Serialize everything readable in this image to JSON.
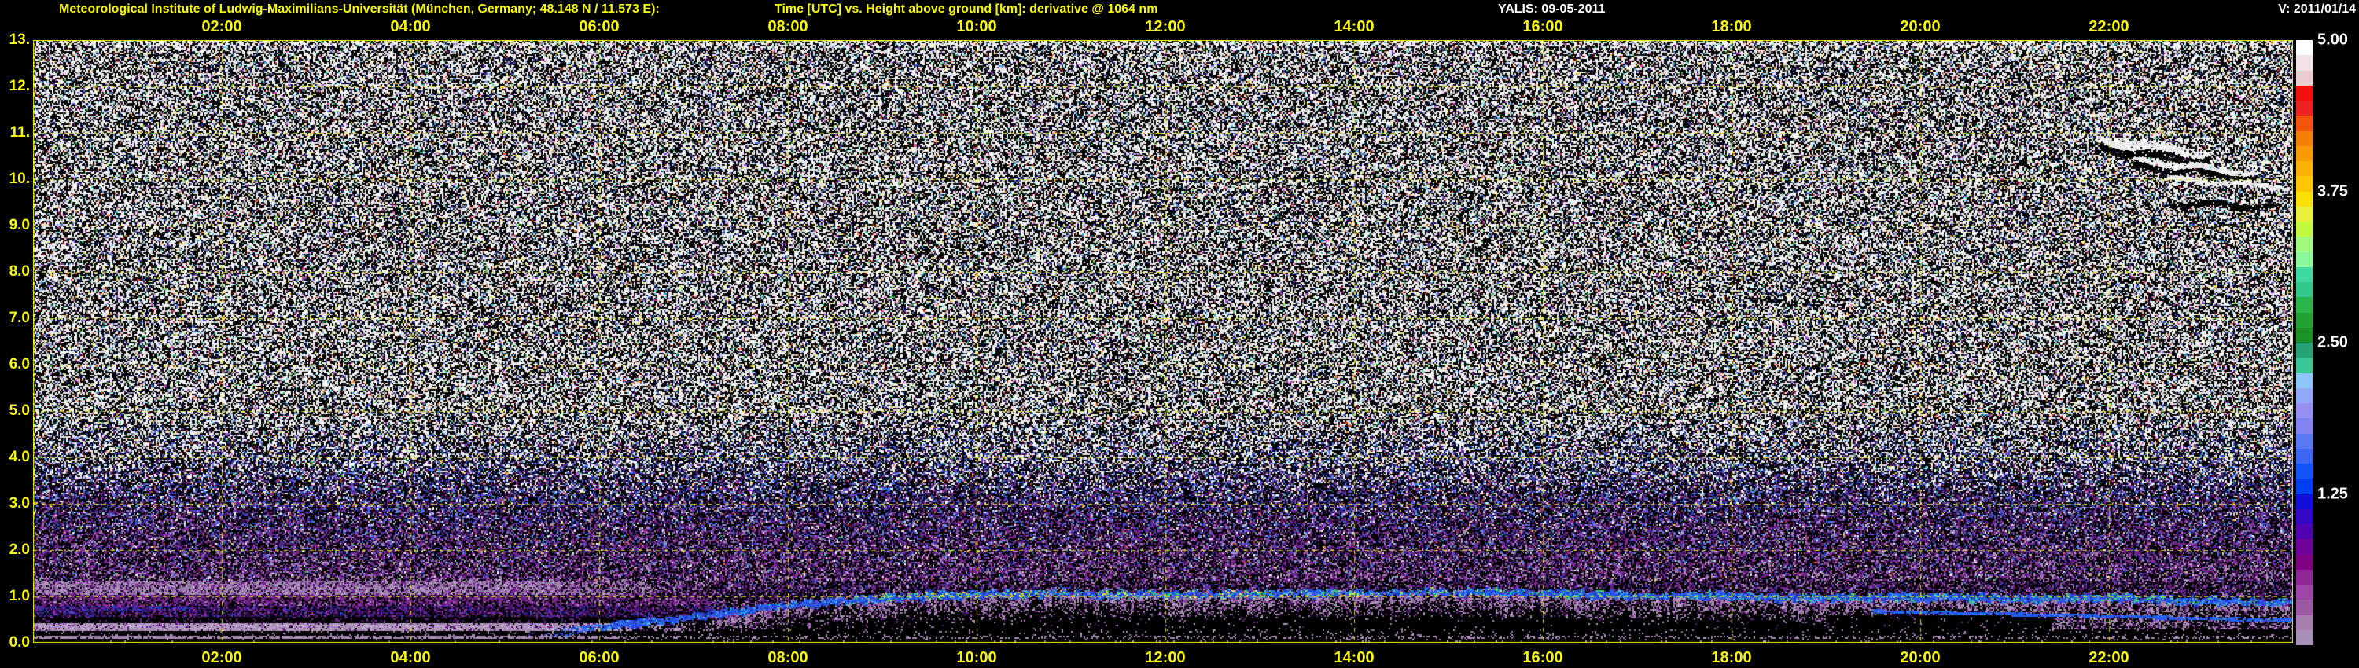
{
  "header": {
    "station": "Meteorological Institute of Ludwig-Maximilians-Universität (München, Germany; 48.148 N / 11.573 E):",
    "plot_title": "Time [UTC] vs. Height above ground [km]: derivative @ 1064 nm",
    "system_date": "YALIS: 09-05-2011",
    "version": "V: 2011/01/14"
  },
  "colors": {
    "background": "#000000",
    "frame": "#f0f000",
    "grid": "#e2e200",
    "label_yellow": "#f8f800",
    "label_white": "#ffffff"
  },
  "chart_data": {
    "type": "heatmap",
    "title": "Time [UTC] vs. Height above ground [km]: derivative @ 1064 nm",
    "wavelength": "1064 nm",
    "date": "09-05-2011",
    "x_axis": {
      "label": "Time [UTC]",
      "range_hours": [
        0,
        24
      ],
      "tick_hours": [
        2,
        4,
        6,
        8,
        10,
        12,
        14,
        16,
        18,
        20,
        22
      ],
      "ticks": [
        "02:00",
        "04:00",
        "06:00",
        "08:00",
        "10:00",
        "12:00",
        "14:00",
        "16:00",
        "18:00",
        "20:00",
        "22:00"
      ]
    },
    "y_axis": {
      "label": "Height above ground [km]",
      "range_km": [
        0,
        13
      ],
      "tick_values": [
        13,
        12,
        11,
        10,
        9,
        8,
        7,
        6,
        5,
        4,
        3,
        2,
        1,
        0
      ],
      "tick_labels": [
        "13.",
        "12.",
        "11.",
        "10.",
        "9.0",
        "8.0",
        "7.0",
        "6.0",
        "5.0",
        "4.0",
        "3.0",
        "2.0",
        "1.0",
        "0.0"
      ]
    },
    "colorbar": {
      "range": [
        0,
        5
      ],
      "tick_values": [
        5.0,
        3.75,
        2.5,
        1.25
      ],
      "tick_labels": [
        "5.00",
        "3.75",
        "2.50",
        "1.25"
      ],
      "colors": [
        "#ffffff",
        "#f2e4e6",
        "#eaccd0",
        "#f50f0f",
        "#ee2222",
        "#f4530a",
        "#f67f06",
        "#f89a02",
        "#fbb201",
        "#fcc601",
        "#fadf00",
        "#e8f03c",
        "#c2f83e",
        "#a2f87c",
        "#8bf89b",
        "#3edaa2",
        "#32c88c",
        "#2ab44c",
        "#22a232",
        "#1c9224",
        "#27a276",
        "#3bc698",
        "#8ec6f8",
        "#8fa8f8",
        "#988ff2",
        "#8282f0",
        "#5a78f2",
        "#3e66f4",
        "#1256fa",
        "#0140f0",
        "#120fd8",
        "#3207c6",
        "#5102b0",
        "#6f0098",
        "#7f0282",
        "#8f2696",
        "#9e46a6",
        "#9c58a2",
        "#a87eb0",
        "#a88fb8"
      ]
    },
    "boundary_layer": {
      "description": "aerosol mixed-layer top detected as blue/cyan/green line, km vs UTC hour",
      "points": [
        [
          5.2,
          0.18
        ],
        [
          6,
          0.33
        ],
        [
          6.5,
          0.45
        ],
        [
          7,
          0.55
        ],
        [
          7.5,
          0.68
        ],
        [
          8,
          0.8
        ],
        [
          8.5,
          0.88
        ],
        [
          9,
          0.95
        ],
        [
          10,
          1.03
        ],
        [
          11,
          1.06
        ],
        [
          12,
          1.03
        ],
        [
          13,
          1.06
        ],
        [
          14,
          1.06
        ],
        [
          15,
          1.09
        ],
        [
          16,
          1.06
        ],
        [
          17,
          1.03
        ],
        [
          18,
          0.99
        ],
        [
          19,
          0.96
        ],
        [
          20,
          0.98
        ],
        [
          21,
          0.94
        ],
        [
          22,
          0.96
        ],
        [
          23,
          0.9
        ],
        [
          23.95,
          0.86
        ]
      ]
    },
    "secondary_layer": {
      "points": [
        [
          19.5,
          0.68
        ],
        [
          23.95,
          0.48
        ]
      ]
    },
    "render": {
      "geometry": {
        "plotLeft": 42,
        "plotTop": 51,
        "plotW": 2874,
        "plotH": 767,
        "pxPerHour": 120,
        "pxPerKm": 59,
        "topLabelY": 23,
        "bottomLabelY": 826,
        "cbLeft": 2920,
        "cbTop": 51,
        "cbW": 21,
        "cbH": 770,
        "cbLblLeft": 2947
      },
      "noise_zones": [
        {
          "h": 13.0,
          "w": {
            "white": 0.43,
            "black": 0.45,
            "gray": 0.04,
            "colored": 0.05,
            "blue": 0.02,
            "purple": 0.01,
            "mauve": 0.0
          }
        },
        {
          "h": 5.0,
          "w": {
            "white": 0.43,
            "black": 0.45,
            "gray": 0.04,
            "colored": 0.05,
            "blue": 0.02,
            "purple": 0.01,
            "mauve": 0.0
          }
        },
        {
          "h": 4.0,
          "w": {
            "white": 0.3,
            "black": 0.46,
            "gray": 0.02,
            "colored": 0.04,
            "blue": 0.12,
            "purple": 0.05,
            "mauve": 0.01
          }
        },
        {
          "h": 3.1,
          "w": {
            "white": 0.08,
            "black": 0.49,
            "gray": 0.01,
            "colored": 0.03,
            "blue": 0.18,
            "purple": 0.17,
            "mauve": 0.04
          }
        },
        {
          "h": 2.6,
          "w": {
            "white": 0.04,
            "black": 0.47,
            "gray": 0.0,
            "colored": 0.02,
            "blue": 0.13,
            "purple": 0.25,
            "mauve": 0.09
          }
        },
        {
          "h": 2.1,
          "w": {
            "white": 0.02,
            "black": 0.46,
            "gray": 0.0,
            "colored": 0.02,
            "blue": 0.09,
            "purple": 0.29,
            "mauve": 0.12
          }
        },
        {
          "h": 1.6,
          "w": {
            "white": 0.01,
            "black": 0.45,
            "gray": 0.0,
            "colored": 0.01,
            "blue": 0.05,
            "purple": 0.31,
            "mauve": 0.17
          }
        },
        {
          "h": 1.35,
          "w": {
            "white": 0.01,
            "black": 0.44,
            "gray": 0.0,
            "colored": 0.01,
            "blue": 0.04,
            "purple": 0.3,
            "mauve": 0.2
          }
        }
      ],
      "palettes": {
        "white": [
          "#ffffff",
          "#f0f0f0",
          "#e2e2e2"
        ],
        "black": [
          "#000000",
          "#060606"
        ],
        "gray": [
          "#a0a0a0",
          "#787878",
          "#c6c6c6"
        ],
        "colored": [
          "#f0e820",
          "#e03028",
          "#28c050",
          "#2890e0",
          "#30c8d0",
          "#d838c8",
          "#f07820",
          "#6858f0"
        ],
        "blue": [
          "#3048c8",
          "#4468e8",
          "#2334a8",
          "#5a80f0"
        ],
        "purple": [
          "#6a2088",
          "#541470",
          "#7c2a9a",
          "#8c2aa0"
        ],
        "mauve": [
          "#a88cb4",
          "#b49cc0",
          "#9878a8"
        ],
        "mauve2": [
          "#a88cb4",
          "#b49cc0",
          "#9878a8",
          "#8f72a0"
        ],
        "purpleF": [
          "#6a2088",
          "#7c2a9a",
          "#5a1678"
        ],
        "magenta": [
          "#8c2a9c",
          "#9a34a8"
        ],
        "deepBand": [
          "#50187c",
          "#44106a",
          "#3c0a60"
        ],
        "blueStreak": [
          "#3038c0",
          "#2a48d8",
          "#1a2a9a"
        ],
        "mauveBand": [
          "#ae94bc",
          "#bfa8ca",
          "#a287b2"
        ],
        "thinLine": [
          "#b096be",
          "#a488b0"
        ],
        "lineBlue": [
          "#2444d8",
          "#2e56ea",
          "#1a34c0",
          "#3a66ee"
        ],
        "blueBright": [
          "#2858f0",
          "#1b6cf8"
        ],
        "cyan": [
          "#38b0e8",
          "#40c8f0",
          "#2a90d8"
        ],
        "green": [
          "#34c85c",
          "#2ad876",
          "#5ad848"
        ],
        "yellowL": [
          "#e8e434",
          "#f0f050",
          "#c8e028"
        ],
        "redL": [
          "#e04040",
          "#f06060"
        ]
      },
      "cloud": {
        "description": "cirrus cloud streaks upper right ~22:00-24:00 UTC near 10-11 km",
        "streaks": [
          {
            "t0": 21.85,
            "t1": 23.05,
            "h0": 10.85,
            "h1": 10.55,
            "hw": 0.1,
            "amp": 0.05,
            "phase": 0,
            "color": "white",
            "shadow": 0.15
          },
          {
            "t0": 22.25,
            "t1": 23.55,
            "h0": 10.42,
            "h1": 10.12,
            "hw": 0.065,
            "amp": 0.045,
            "phase": 2.1,
            "color": "white",
            "shadow": 0.1
          },
          {
            "t0": 22.55,
            "t1": 23.9,
            "h0": 10.02,
            "h1": 9.84,
            "hw": 0.045,
            "amp": 0.04,
            "phase": 4.2,
            "color": "white",
            "shadow": 0
          },
          {
            "t0": 22.6,
            "t1": 23.85,
            "h0": 9.48,
            "h1": 9.4,
            "hw": 0.055,
            "amp": 0.05,
            "phase": 1.0,
            "color": "black",
            "shadow": 0
          }
        ]
      }
    }
  }
}
